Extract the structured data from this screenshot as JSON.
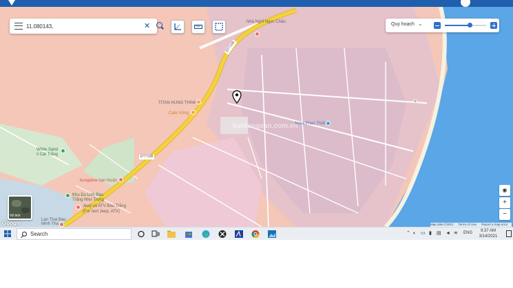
{
  "search": {
    "value": "11.080143,"
  },
  "layer_panel": {
    "selected": "Quy hoạch",
    "opacity": 0.6
  },
  "map_labels": {
    "nha_nghi": "Nhà Nghỉ Ngọc Châu",
    "road_1": "ĐT716B",
    "road_2": "ĐT716B",
    "titan": "TITAN HUNG THINH",
    "cafe": "Cafe Vững",
    "nova": "Nova Phan Thiết",
    "white_sand_1": "White Sand",
    "white_sand_2": "Ii Cát Trắng",
    "bungalow": "bungalow bạn thuận",
    "khu_du_lich_1": "Khu Du Lịch Bàu",
    "khu_du_lich_2": "Trắng Như Trung",
    "jeep_1": "Jeep và ATV Bàu Trắng",
    "jeep_2": "(For rent Jeep, ATV)",
    "thai_bau_1": "Lan Thai Bau",
    "thai_bau_2": "Minh Tha"
  },
  "watermark": {
    "text": "batdongsan.com.vn"
  },
  "sat_thumb": {
    "label": "Vệ tinh"
  },
  "google_logo": "Google",
  "attribution": {
    "map_data": "Map data ©2021",
    "terms": "Terms of Use",
    "report": "Report a map error"
  },
  "taskbar": {
    "search_label": "Search",
    "language": "ENG",
    "time": "9:37 AM",
    "date": "3/14/2021"
  },
  "colors": {
    "accent": "#1f5fae",
    "map_land": "#f4c7b8",
    "map_plan_zone": "#efc7cf",
    "map_dense_zone": "#e3c3cf",
    "sea": "#5aa6e6",
    "main_road": "#f3d23f"
  },
  "icons": {
    "menu": "menu-icon",
    "clear": "close-icon",
    "search": "search-icon",
    "measure": "measure-angle-icon",
    "ruler": "ruler-icon",
    "area": "area-select-icon",
    "location_pin": "map-pin-icon"
  }
}
